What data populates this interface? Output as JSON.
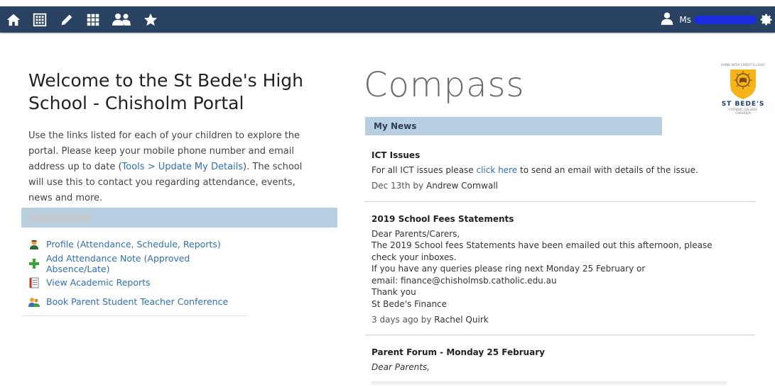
{
  "topbar": {
    "icons": [
      "home-icon",
      "calendar-icon",
      "pencil-icon",
      "grid-icon",
      "people-icon",
      "star-icon"
    ],
    "user_label": "Ms",
    "settings_icon": "gear-icon",
    "bg_color": "#2a4261"
  },
  "welcome": {
    "title": "Welcome to the St Bede's High School - Chisholm Portal",
    "intro_1": "Use the links listed for each of your children to explore the portal. Please keep your mobile phone number and email address up to date (",
    "intro_link": "Tools > Update My Details",
    "intro_2": "). The school will use this to contact you regarding attendance, events, news and more."
  },
  "child_links": [
    {
      "label": "Profile (Attendance, Schedule, Reports)",
      "icon": "student-profile-icon"
    },
    {
      "label": "Add Attendance Note (Approved Absence/Late)",
      "icon": "plus-icon"
    },
    {
      "label": "View Academic Reports",
      "icon": "report-icon"
    },
    {
      "label": "Book Parent Student Teacher Conference",
      "icon": "conference-icon"
    }
  ],
  "brand": {
    "logo_text": "Compass",
    "crest_motto": "SHINE WITH CHRIST'S LIGHT",
    "crest_title": "ST BEDE'S",
    "crest_sub1": "CATHOLIC COLLEGE",
    "crest_sub2": "CHISHOLM"
  },
  "news": {
    "header": "My News",
    "items": [
      {
        "title": "ICT Issues",
        "body_pre": "For all ICT issues please ",
        "body_link": "click here",
        "body_post": " to send an email with details of the issue.",
        "date": "Dec 13th by",
        "author": "Andrew Cornwall"
      },
      {
        "title": "2019 School Fees Statements",
        "lines": [
          "Dear Parents/Carers,",
          "The 2019 School fees Statements have been emailed out this afternoon, please check your inboxes.",
          "If you have any queries please ring next Monday 25 February or",
          "email:  finance@chisholmsb.catholic.edu.au",
          "Thank you",
          "St Bede's Finance"
        ],
        "date": "3 days ago by",
        "author": "Rachel Quirk"
      },
      {
        "title": "Parent Forum - Monday 25 February",
        "lines": [
          "Dear Parents,"
        ]
      }
    ]
  }
}
